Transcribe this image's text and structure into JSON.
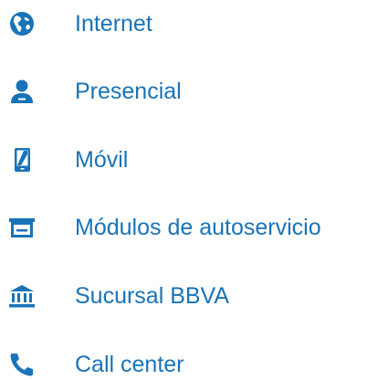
{
  "colors": {
    "text": "#1973b8",
    "icon": "#1973b8",
    "background": "#ffffff"
  },
  "channels": [
    {
      "label": "Internet",
      "icon": "globe-icon"
    },
    {
      "label": "Presencial",
      "icon": "person-icon"
    },
    {
      "label": "Móvil",
      "icon": "mobile-phone-icon"
    },
    {
      "label": "Módulos de autoservicio",
      "icon": "self-service-kiosk-icon"
    },
    {
      "label": "Sucursal BBVA",
      "icon": "bank-branch-icon"
    },
    {
      "label": "Call center",
      "icon": "phone-handset-icon"
    }
  ]
}
